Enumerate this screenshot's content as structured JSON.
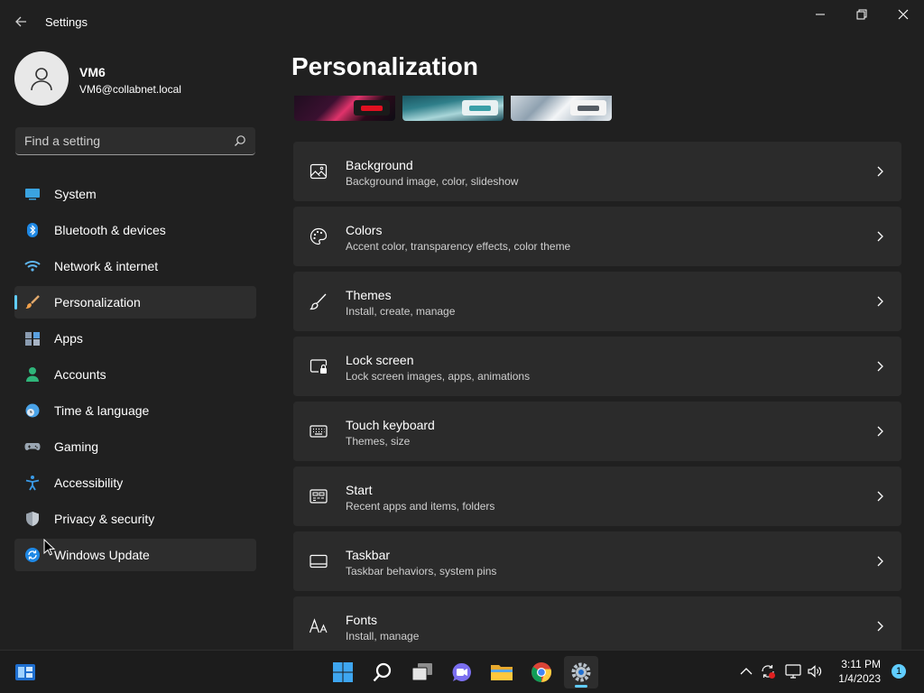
{
  "window": {
    "title": "Settings"
  },
  "profile": {
    "name": "VM6",
    "email": "VM6@collabnet.local"
  },
  "search": {
    "placeholder": "Find a setting"
  },
  "sidebar": {
    "items": [
      {
        "label": "System",
        "icon": "system-icon"
      },
      {
        "label": "Bluetooth & devices",
        "icon": "bluetooth-icon"
      },
      {
        "label": "Network & internet",
        "icon": "wifi-icon"
      },
      {
        "label": "Personalization",
        "icon": "brush-icon",
        "active": true
      },
      {
        "label": "Apps",
        "icon": "apps-icon"
      },
      {
        "label": "Accounts",
        "icon": "accounts-icon"
      },
      {
        "label": "Time & language",
        "icon": "clock-globe-icon"
      },
      {
        "label": "Gaming",
        "icon": "gamepad-icon"
      },
      {
        "label": "Accessibility",
        "icon": "accessibility-icon"
      },
      {
        "label": "Privacy & security",
        "icon": "shield-icon"
      },
      {
        "label": "Windows Update",
        "icon": "update-icon"
      }
    ]
  },
  "main": {
    "title": "Personalization",
    "cards": [
      {
        "title": "Background",
        "subtitle": "Background image, color, slideshow",
        "icon": "image-icon"
      },
      {
        "title": "Colors",
        "subtitle": "Accent color, transparency effects, color theme",
        "icon": "palette-icon"
      },
      {
        "title": "Themes",
        "subtitle": "Install, create, manage",
        "icon": "brush-icon"
      },
      {
        "title": "Lock screen",
        "subtitle": "Lock screen images, apps, animations",
        "icon": "lock-screen-icon"
      },
      {
        "title": "Touch keyboard",
        "subtitle": "Themes, size",
        "icon": "keyboard-icon"
      },
      {
        "title": "Start",
        "subtitle": "Recent apps and items, folders",
        "icon": "start-icon"
      },
      {
        "title": "Taskbar",
        "subtitle": "Taskbar behaviors, system pins",
        "icon": "taskbar-icon"
      },
      {
        "title": "Fonts",
        "subtitle": "Install, manage",
        "icon": "fonts-icon"
      }
    ]
  },
  "taskbar": {
    "apps": [
      "start-icon",
      "search-icon",
      "task-view-icon",
      "chat-icon",
      "file-explorer-icon",
      "chrome-icon",
      "settings-icon"
    ],
    "clock": {
      "time": "3:11 PM",
      "date": "1/4/2023"
    },
    "notifications": "1"
  },
  "colors": {
    "background": "#202020",
    "card": "#2b2b2b",
    "accent": "#60cdff"
  }
}
